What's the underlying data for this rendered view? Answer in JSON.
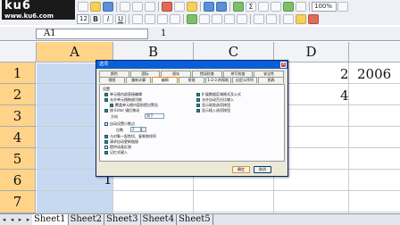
{
  "watermark": {
    "brand": "ku6",
    "url": "www.ku6.com"
  },
  "toolbar": {
    "font_size": "12",
    "zoom": "100%",
    "format_labels": [
      "B",
      "I",
      "U"
    ],
    "sum_symbol": "Σ"
  },
  "formula_bar": {
    "name_box": "A1",
    "value": "1"
  },
  "grid": {
    "columns": [
      "A",
      "B",
      "C",
      "D"
    ],
    "rows": [
      "1",
      "2",
      "3",
      "4",
      "5",
      "6",
      "7"
    ],
    "cells": {
      "D1": "2",
      "E1": "2006",
      "D2": "4",
      "B6": "1"
    }
  },
  "sheet_tabs": [
    "Sheet1",
    "Sheet2",
    "Sheet3",
    "Sheet4",
    "Sheet5"
  ],
  "dialog": {
    "title": "选项",
    "tabs_row1": [
      "颜色",
      "国际",
      "保存",
      "错误检查",
      "拼写检查",
      "安全性"
    ],
    "tabs_row2": [
      "视图",
      "重新计算",
      "编辑",
      "常规",
      "1-2-3 的帮助",
      "自定义序列",
      "图表"
    ],
    "active_tab": "编辑",
    "settings_label": "设置",
    "left_options": [
      {
        "label": "单元格内部直接编辑",
        "checked": true
      },
      {
        "label": "允许单元格拖放功能",
        "checked": true
      },
      {
        "label": "覆盖单元格内容前提出警告",
        "checked": true
      },
      {
        "label": "按 Enter 键后移动",
        "checked": true
      },
      {
        "label": "自动设置小数点",
        "checked": false
      },
      {
        "label": "与对象一起剪切、复制和排序",
        "checked": true
      },
      {
        "label": "请求自动更新链接",
        "checked": true
      },
      {
        "label": "提供动画反馈",
        "checked": false
      },
      {
        "label": "记忆式键入",
        "checked": true
      }
    ],
    "right_options": [
      {
        "label": "扩展数据区域格式及公式",
        "checked": true
      },
      {
        "label": "允许自动百分比输入",
        "checked": true
      },
      {
        "label": "显示粘贴选项按钮",
        "checked": true
      },
      {
        "label": "显示插入选项按钮",
        "checked": true
      }
    ],
    "direction_label": "方向",
    "direction_value": "向下",
    "decimal_label": "位数",
    "decimal_value": "2",
    "ok_label": "确定",
    "cancel_label": "取消"
  }
}
